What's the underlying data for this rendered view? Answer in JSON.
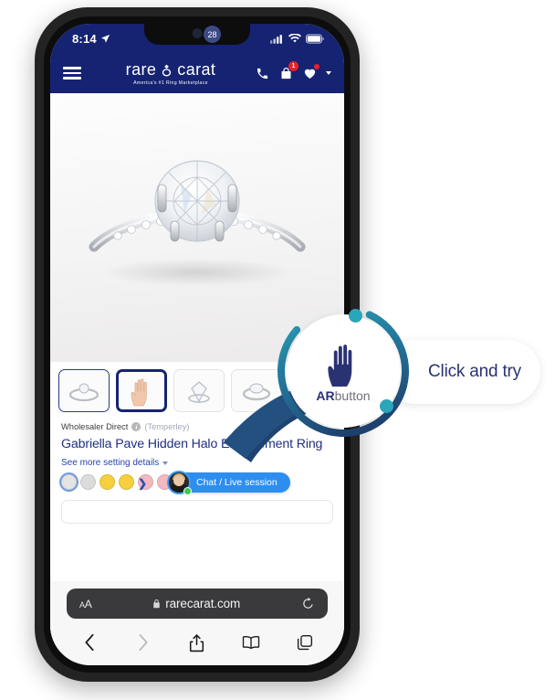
{
  "status_bar": {
    "time": "8:14",
    "location_icon": "location-arrow-icon",
    "signal_icon": "cellular-signal-icon",
    "wifi_icon": "wifi-icon",
    "battery_icon": "battery-icon"
  },
  "site_header": {
    "menu_icon": "hamburger-menu-icon",
    "brand_left": "rare",
    "brand_right": "carat",
    "brand_gem_icon": "diamond-ring-icon",
    "tagline": "America's #1 Ring Marketplace",
    "phone_icon": "phone-icon",
    "bag_icon": "shopping-bag-icon",
    "bag_badge": "1",
    "wishlist_icon": "heart-icon",
    "caret_icon": "chevron-down-icon"
  },
  "hero": {
    "image_alt": "engagement-ring-photo"
  },
  "thumbnails": {
    "badge_count": "28",
    "items": [
      {
        "name": "thumbnail-ring-front",
        "type": "ring"
      },
      {
        "name": "thumbnail-ar-hand",
        "type": "hand"
      },
      {
        "name": "thumbnail-ring-top",
        "type": "ring"
      },
      {
        "name": "thumbnail-ring-angle",
        "type": "ring"
      },
      {
        "name": "thumbnail-ring-extra",
        "type": "ring"
      }
    ]
  },
  "product": {
    "wholesaler_label": "Wholesaler Direct",
    "info_icon": "info-icon",
    "vendor": "(Temperley)",
    "title": "Gabriella Pave Hidden Halo Engagement Ring",
    "setting_details_link": "See more setting details",
    "setting_details_caret": "chevron-down-icon"
  },
  "swatches": {
    "arrow_icon": "chevron-right-icon",
    "colors": [
      {
        "name": "swatch-platinum",
        "hex": "#e4e4e4",
        "selected": true
      },
      {
        "name": "swatch-white-gold",
        "hex": "#dcdcdc",
        "selected": false
      },
      {
        "name": "swatch-yellow-gold",
        "hex": "#f5cf3e",
        "selected": false
      },
      {
        "name": "swatch-yellow-gold-2",
        "hex": "#f5cf3e",
        "selected": false
      },
      {
        "name": "swatch-rose-gold",
        "hex": "#f3b9c0",
        "selected": false
      },
      {
        "name": "swatch-rose-gold-2",
        "hex": "#f3b9c0",
        "selected": false
      }
    ]
  },
  "chat": {
    "label": "Chat / Live session",
    "avatar_name": "agent-avatar",
    "online_status": "online",
    "accent_hex": "#2e8ef0"
  },
  "callout": {
    "ar_bold": "AR",
    "ar_rest": "button",
    "hand_icon": "hand-icon",
    "cta": "Click and try",
    "accent_teal": "#2aa6bb",
    "accent_navy": "#1f3a6e"
  },
  "safari": {
    "text_size_label": "AA",
    "lock_icon": "lock-icon",
    "url": "rarecarat.com",
    "reload_icon": "reload-icon",
    "back_icon": "chevron-left-icon",
    "forward_icon": "chevron-right-icon",
    "share_icon": "share-icon",
    "bookmarks_icon": "book-icon",
    "tabs_icon": "tabs-icon"
  },
  "theme": {
    "brand_navy": "#152372",
    "title_navy": "#20307e",
    "badge_red": "#e8202a"
  }
}
